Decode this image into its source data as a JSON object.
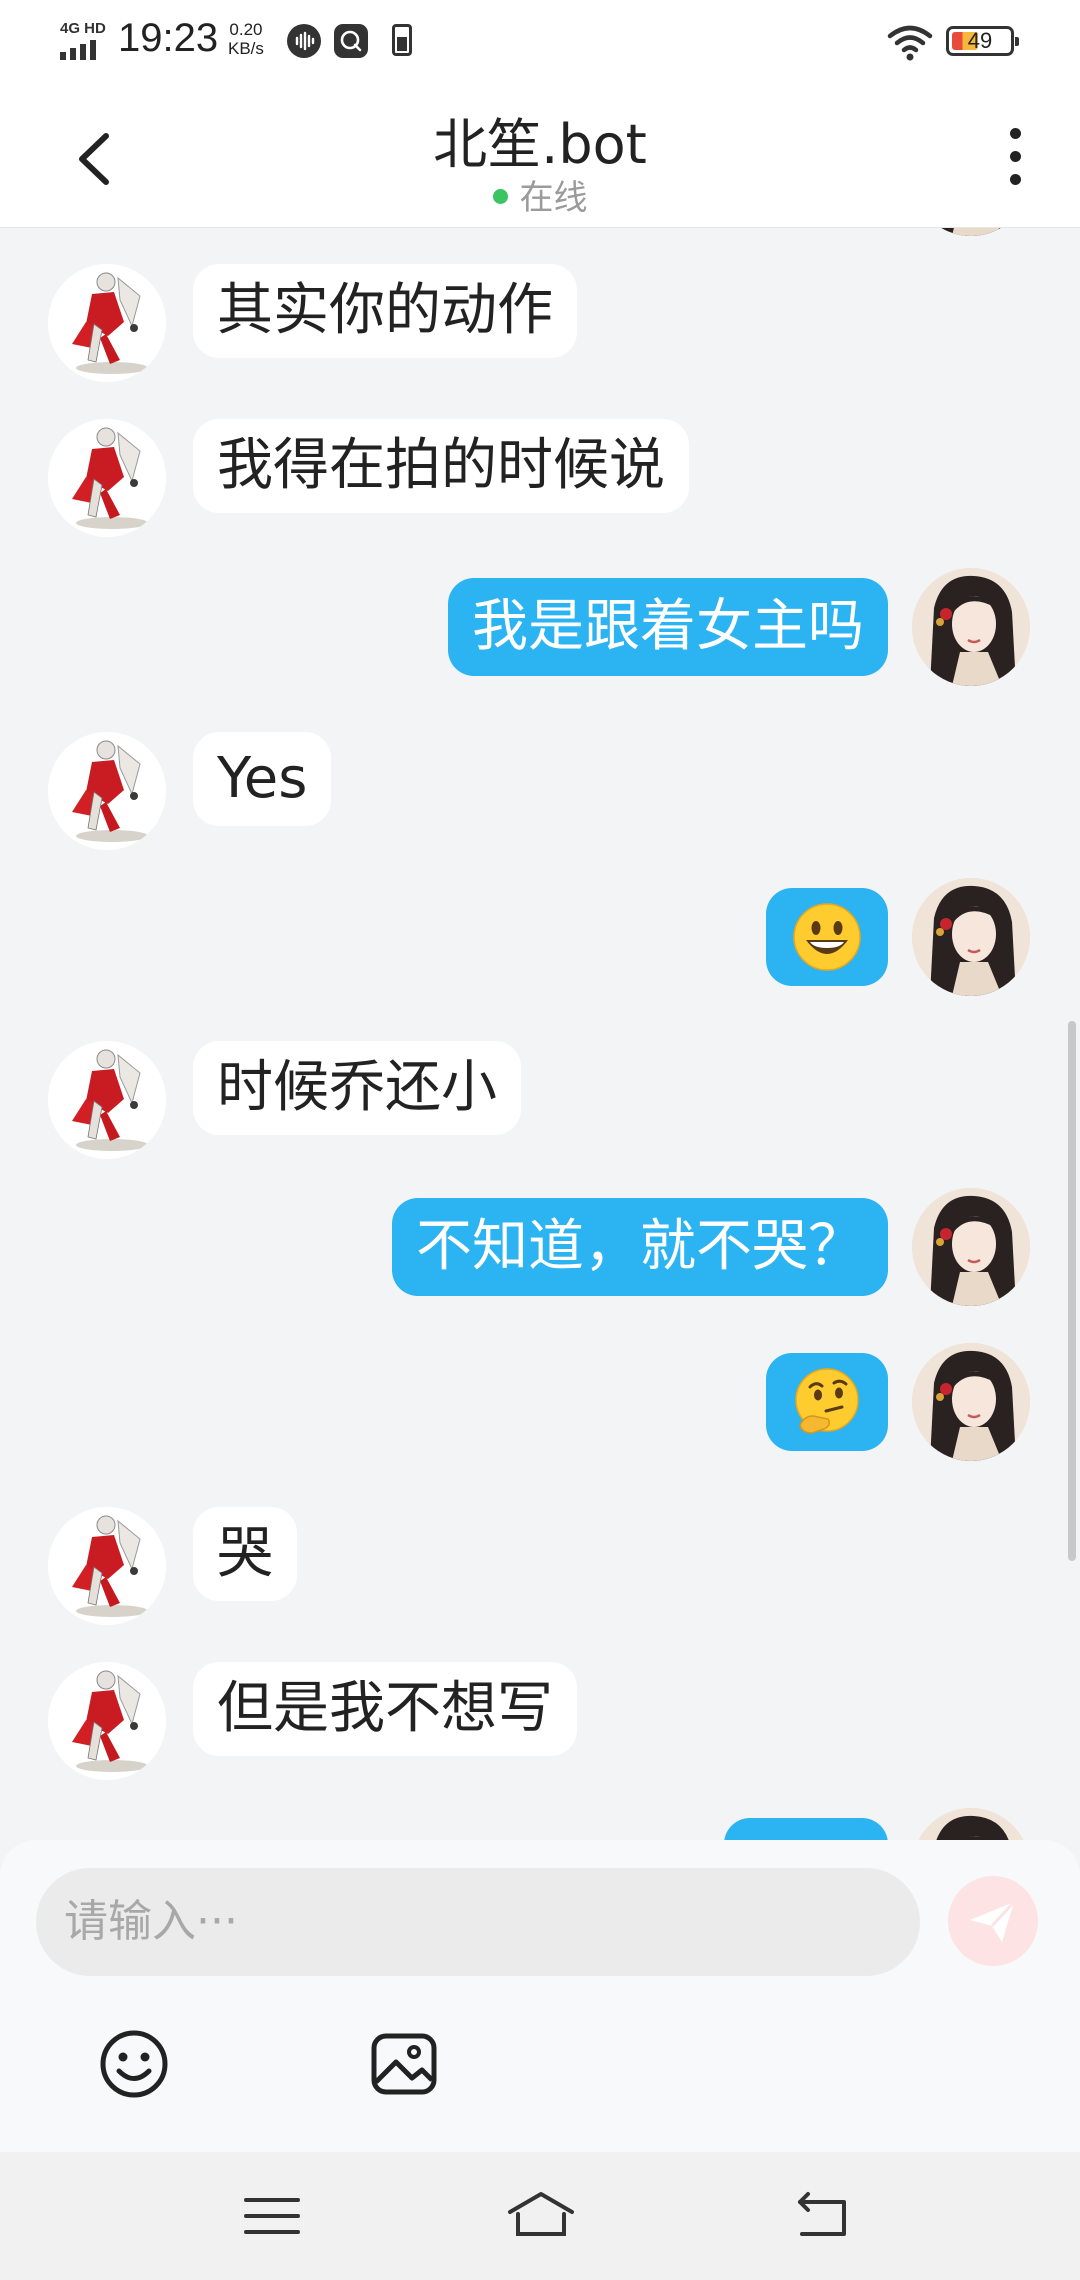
{
  "status_bar": {
    "network": "4G HD",
    "time": "19:23",
    "speed_value": "0.20",
    "speed_unit": "KB/s",
    "battery": "49"
  },
  "header": {
    "title": "北笙.bot",
    "status": "在线"
  },
  "messages": [
    {
      "side": "bot",
      "text": "其实你的动作"
    },
    {
      "side": "bot",
      "text": "我得在拍的时候说"
    },
    {
      "side": "user",
      "text": "我是跟着女主吗"
    },
    {
      "side": "bot",
      "text": "Yes"
    },
    {
      "side": "user",
      "emoji": "grinning-face"
    },
    {
      "side": "bot",
      "text": "时候乔还小"
    },
    {
      "side": "user",
      "text": "不知道，就不哭？"
    },
    {
      "side": "user",
      "emoji": "thinking-face"
    },
    {
      "side": "bot",
      "text": "哭"
    },
    {
      "side": "bot",
      "text": "但是我不想写"
    }
  ],
  "input": {
    "placeholder": "请输入···"
  },
  "colors": {
    "user_bubble": "#2cb3f1",
    "bot_bubble": "#ffffff",
    "online": "#3ac563",
    "send_button": "#fde3e3"
  },
  "icons": {
    "toolbar": [
      "emoji-icon",
      "image-icon"
    ],
    "nav": [
      "menu-icon",
      "home-icon",
      "back-icon"
    ]
  }
}
